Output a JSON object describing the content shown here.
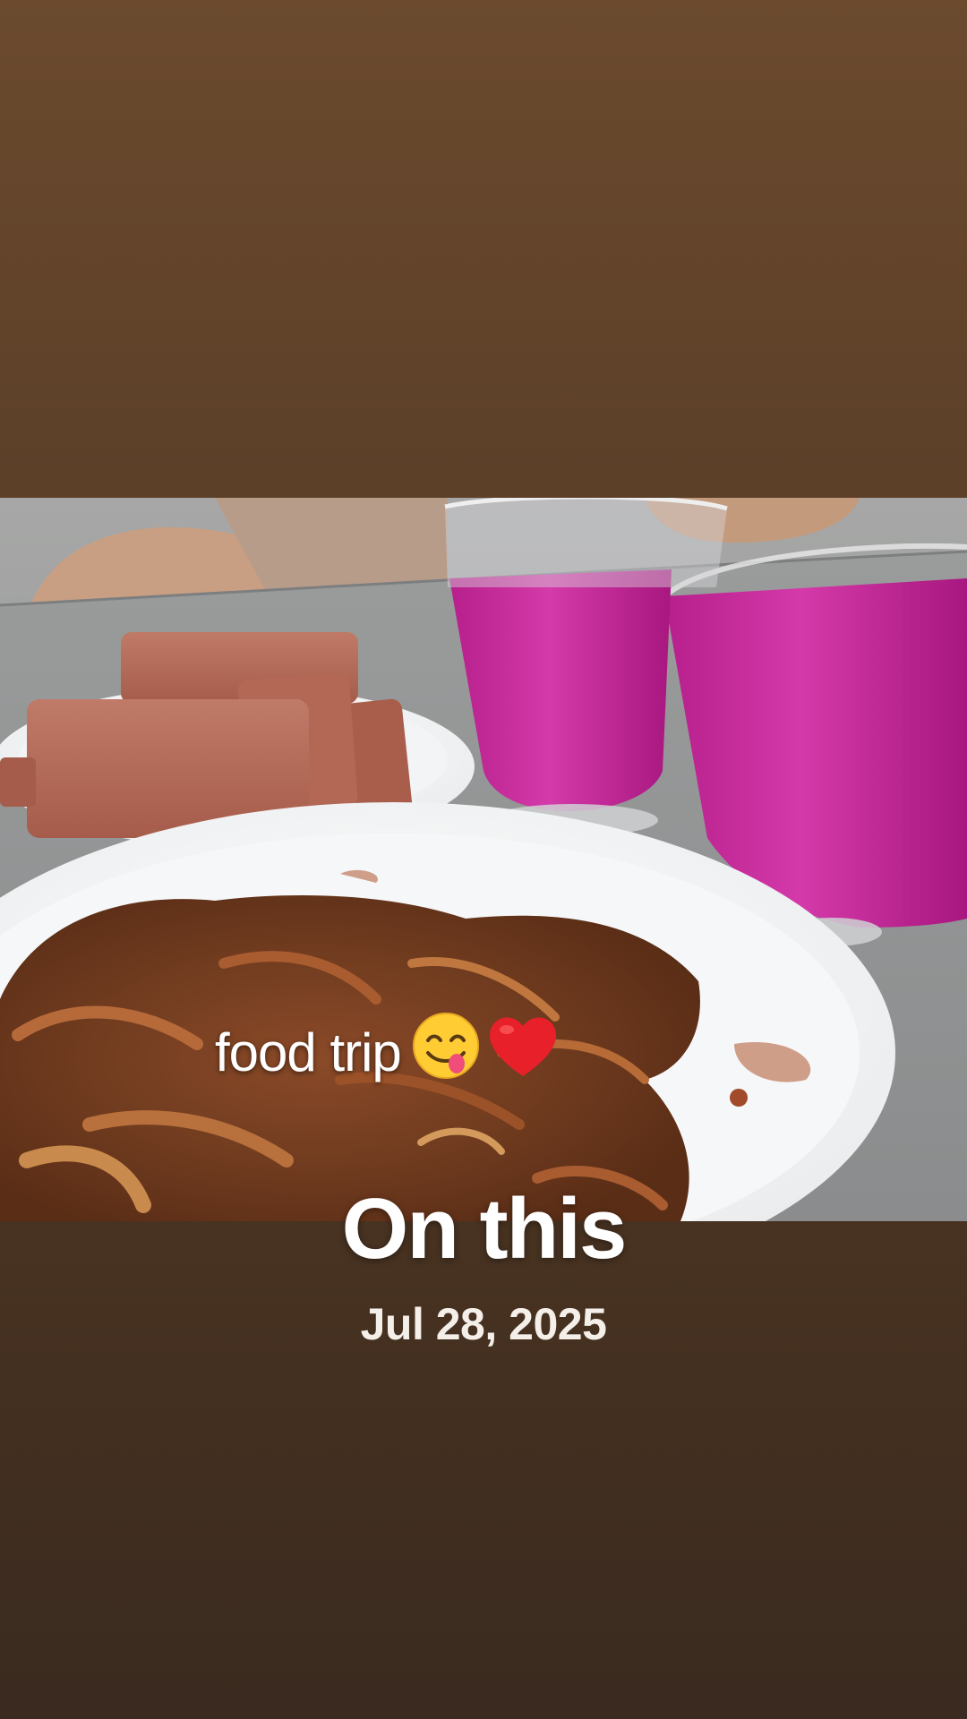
{
  "memory": {
    "caption": "food trip",
    "title": "On this",
    "date": "Jul 28, 2025"
  },
  "icons": {
    "face": "face-savoring-food-icon",
    "heart": "red-heart-icon"
  },
  "colors": {
    "background_top": "#6b4a2e",
    "background_bottom": "#3a2a1f",
    "text": "#ffffff",
    "drink": "#c8249b"
  }
}
